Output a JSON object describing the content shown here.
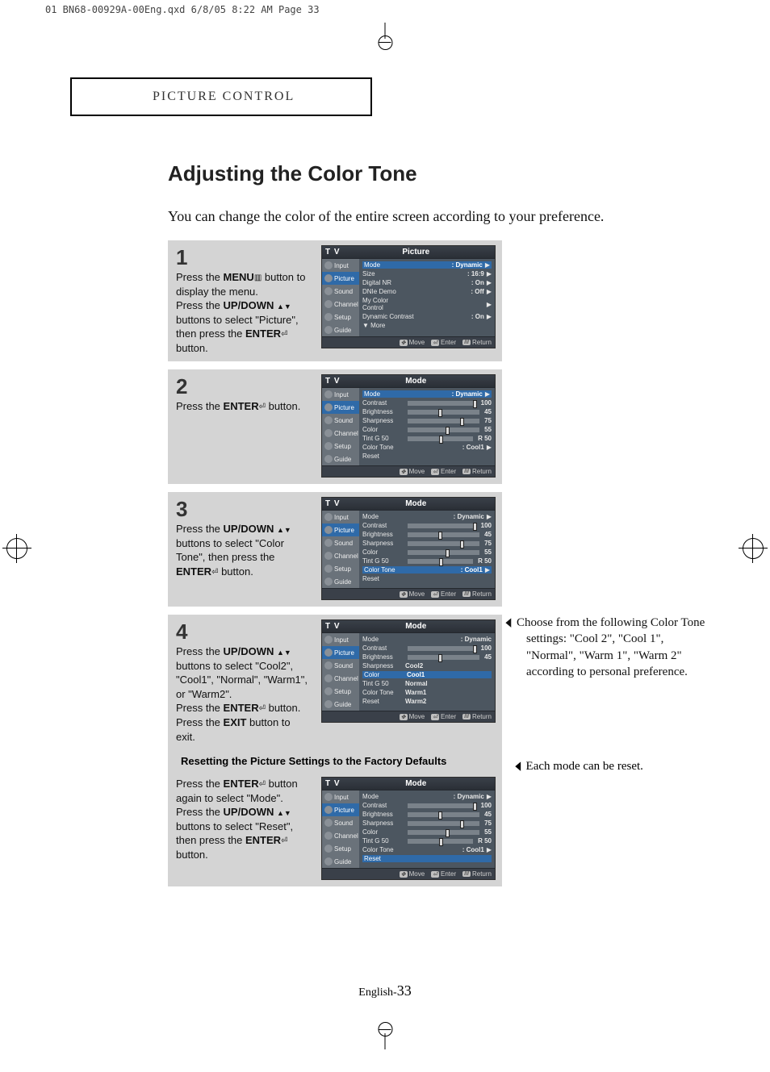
{
  "prepress_header": "01 BN68-00929A-00Eng.qxd  6/8/05 8:22 AM  Page 33",
  "section_title": "PICTURE CONTROL",
  "page_title": "Adjusting the Color Tone",
  "intro_text": "You can change the color of the entire screen according to your preference.",
  "page_number_prefix": "English-",
  "page_number": "33",
  "icons": {
    "menu_glyph": "▥",
    "updown_glyph": "▲▼",
    "enter_glyph": "⏎",
    "left_tri": "◀",
    "right_tri": "▶",
    "move_glyph": "✥"
  },
  "steps": {
    "s1": {
      "num": "1",
      "line1a": "Press the ",
      "line1b": "MENU",
      "line1c": " button to display the menu.",
      "line2a": "Press the ",
      "line2b": "UP/DOWN",
      "line2c": " buttons to select \"Picture\", then press the ",
      "line2d": "ENTER",
      "line2e": " button."
    },
    "s2": {
      "num": "2",
      "line1a": "Press the ",
      "line1b": "ENTER",
      "line1c": "  button."
    },
    "s3": {
      "num": "3",
      "line1a": "Press the ",
      "line1b": "UP/DOWN",
      "line1c": " buttons to select \"Color Tone\", then press the ",
      "line1d": "ENTER",
      "line1e": "  button."
    },
    "s4": {
      "num": "4",
      "line1a": "Press the ",
      "line1b": "UP/DOWN",
      "line1c": " buttons to select \"Cool2\", \"Cool1\", \"Normal\", \"Warm1\", or \"Warm2\".",
      "line2a": "Press the ",
      "line2b": "ENTER",
      "line2c": "  button. Press the ",
      "line2d": "EXIT",
      "line2e": " button to exit."
    },
    "reset_heading": "Resetting the Picture Settings to the Factory Defaults",
    "reset": {
      "line1a": "Press the ",
      "line1b": "ENTER",
      "line1c": "  button again to select \"Mode\". Press the ",
      "line1d": "UP/DOWN",
      "line1e": " buttons to select \"Reset\", then press the ",
      "line1f": "ENTER",
      "line1g": " button."
    }
  },
  "side_note_1": "Choose from the following Color Tone settings: \"Cool 2\", \"Cool 1\", \"Normal\", \"Warm 1\", \"Warm 2\" according to personal preference.",
  "side_note_2": "Each mode can be reset.",
  "osd": {
    "tv": "T V",
    "panel_picture": "Picture",
    "panel_mode": "Mode",
    "side": {
      "input": "Input",
      "picture": "Picture",
      "sound": "Sound",
      "channel": "Channel",
      "setup": "Setup",
      "guide": "Guide"
    },
    "foot": {
      "move": "Move",
      "enter": "Enter",
      "return": "Return"
    },
    "s1_rows": {
      "mode": "Mode",
      "mode_v": ": Dynamic",
      "size": "Size",
      "size_v": ": 16:9",
      "dnr": "Digital NR",
      "dnr_v": ": On",
      "dnie": "DNIe Demo",
      "dnie_v": ": Off",
      "mcc": "My Color Control",
      "dc": "Dynamic Contrast",
      "dc_v": ": On",
      "more": "▼ More"
    },
    "mode_rows": {
      "mode": "Mode",
      "mode_v": ": Dynamic",
      "contrast": "Contrast",
      "contrast_v": "100",
      "contrast_p": 100,
      "bright": "Brightness",
      "bright_v": "45",
      "bright_p": 45,
      "sharp": "Sharpness",
      "sharp_v": "75",
      "sharp_p": 75,
      "color": "Color",
      "color_v": "55",
      "color_p": 55,
      "tint": "Tint  G 50",
      "tint_v": "R 50",
      "tint_p": 50,
      "ct": "Color Tone",
      "ct_v": ": Cool1",
      "reset": "Reset"
    },
    "ct_options": {
      "cool2": "Cool2",
      "cool1": "Cool1",
      "normal": "Normal",
      "warm1": "Warm1",
      "warm2": "Warm2"
    }
  }
}
